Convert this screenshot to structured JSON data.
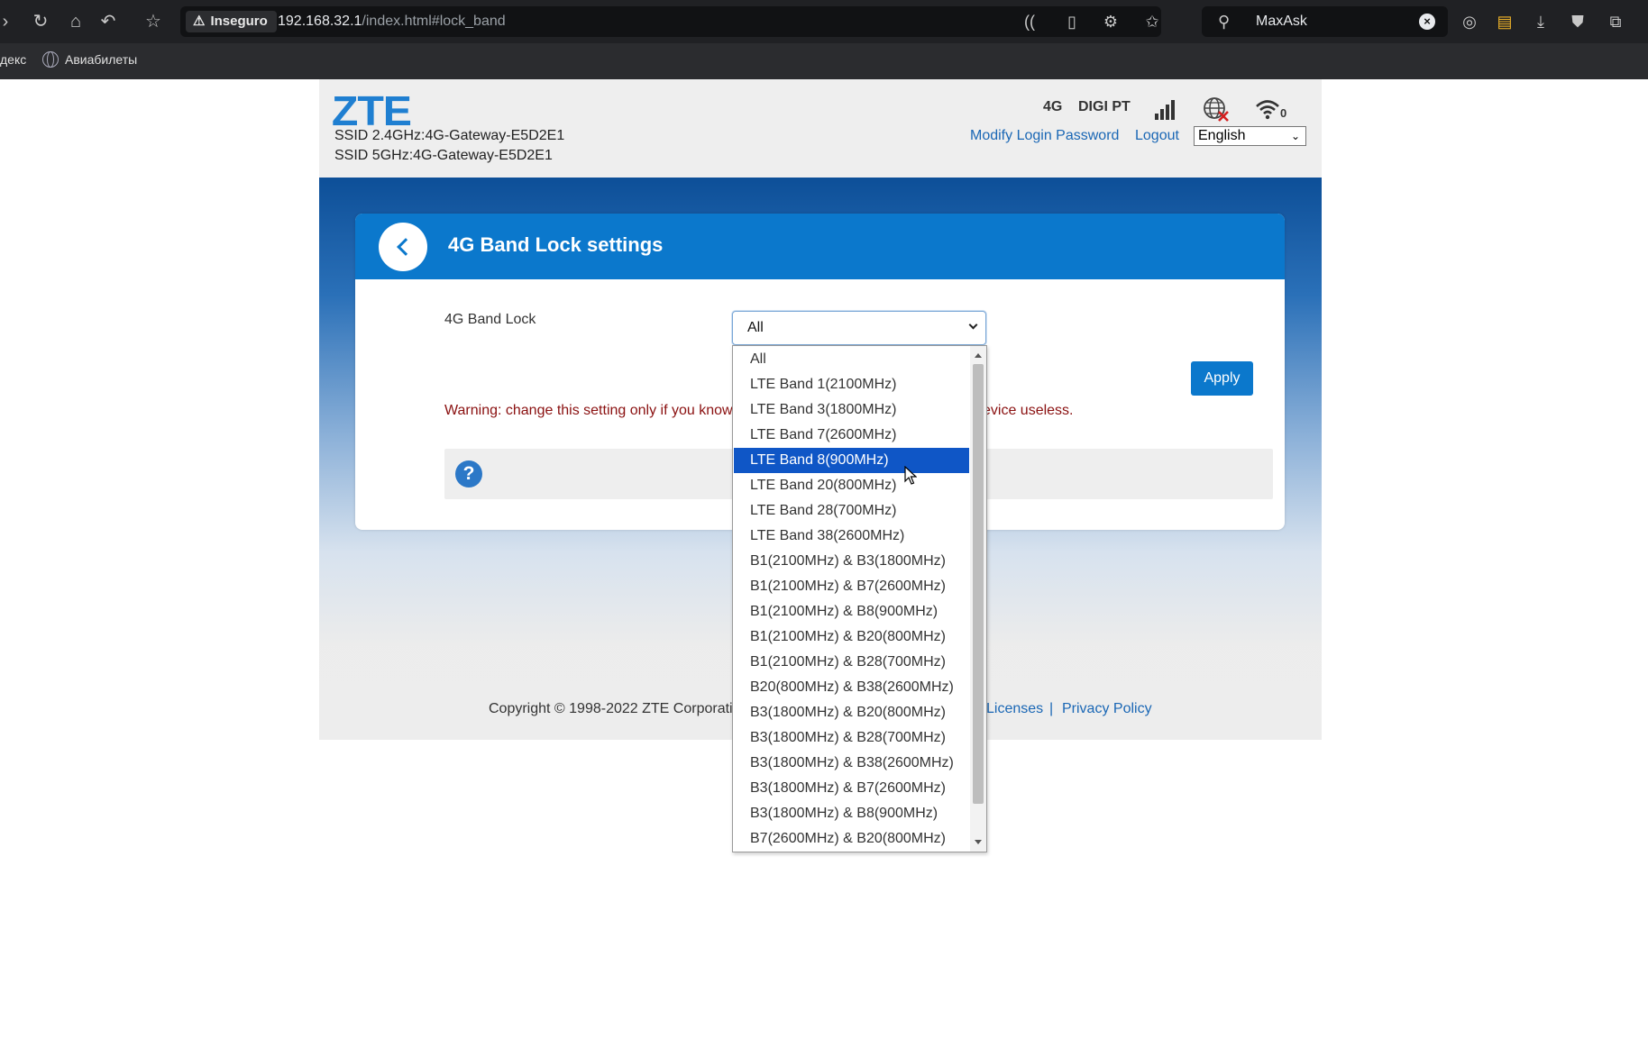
{
  "browser": {
    "insecure_label": "Inseguro",
    "url_host": "192.168.32.1",
    "url_path": "/index.html#lock_band",
    "search_value": "MaxAsk",
    "bookmarks": [
      {
        "label": "декс"
      },
      {
        "label": "Авиабилеты"
      }
    ]
  },
  "header": {
    "logo": "ZTE",
    "ssid_24": "SSID 2.4GHz:4G-Gateway-E5D2E1",
    "ssid_5": "SSID 5GHz:4G-Gateway-E5D2E1",
    "network_type": "4G",
    "operator": "DIGI PT",
    "wifi_clients": "0",
    "modify_password_label": "Modify Login Password",
    "logout_label": "Logout",
    "language_selected": "English"
  },
  "panel": {
    "title": "4G Band Lock settings",
    "field_label": "4G Band Lock",
    "selected_value": "All",
    "apply_label": "Apply",
    "warning_left": "Warning: change this setting only if you know",
    "warning_right": "evice useless.",
    "help_icon_glyph": "?"
  },
  "footer": {
    "copyright": "Copyright © 1998-2022 ZTE Corporati",
    "licenses_label": "Licenses",
    "separator": "|",
    "privacy_label": "Privacy Policy"
  },
  "dropdown": {
    "highlighted_index": 4,
    "options": [
      "All",
      "LTE Band 1(2100MHz)",
      "LTE Band 3(1800MHz)",
      "LTE Band 7(2600MHz)",
      "LTE Band 8(900MHz)",
      "LTE Band 20(800MHz)",
      "LTE Band 28(700MHz)",
      "LTE Band 38(2600MHz)",
      "B1(2100MHz) & B3(1800MHz)",
      "B1(2100MHz) & B7(2600MHz)",
      "B1(2100MHz) & B8(900MHz)",
      "B1(2100MHz) & B20(800MHz)",
      "B1(2100MHz) & B28(700MHz)",
      "B20(800MHz) & B38(2600MHz)",
      "B3(1800MHz) & B20(800MHz)",
      "B3(1800MHz) & B28(700MHz)",
      "B3(1800MHz) & B38(2600MHz)",
      "B3(1800MHz) & B7(2600MHz)",
      "B3(1800MHz) & B8(900MHz)",
      "B7(2600MHz) & B20(800MHz)"
    ]
  },
  "colors": {
    "brand_blue": "#0b78cc",
    "highlight": "#0f56c6",
    "warning": "#8a1010",
    "link": "#1a67b5"
  }
}
